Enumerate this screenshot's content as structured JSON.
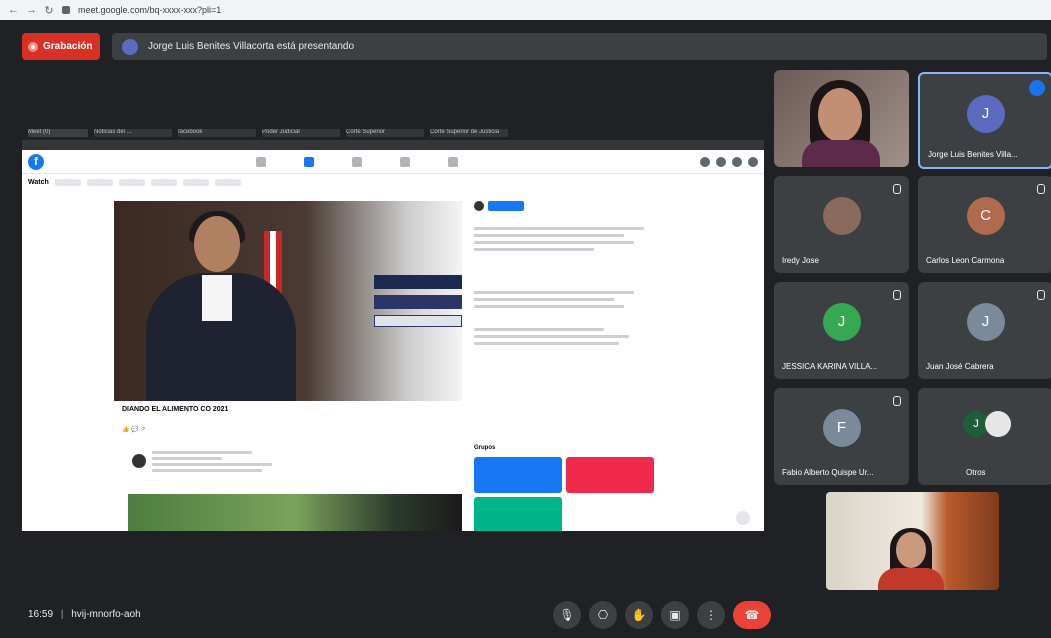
{
  "browser": {
    "back_icon": "arrow-left-icon",
    "forward_icon": "arrow-right-icon",
    "reload_icon": "reload-icon",
    "url": "meet.google.com/bq-xxxx-xxx?pli=1"
  },
  "top_bar": {
    "recording_label": "Grabación",
    "presenting_text": "Jorge Luis Benites Villacorta está presentando"
  },
  "shared_screen": {
    "tabs": [
      "Meet (0)",
      "Noticias del ...",
      "facebook",
      "Poder Judicial",
      "Corte Superior",
      "Corte Superior de Justicia"
    ],
    "watch_label": "Watch",
    "video_title": "DIANDO EL ALIMENTO CO 2021",
    "groups_label": "Grupos"
  },
  "participants": [
    {
      "name": "",
      "type": "camera"
    },
    {
      "name": "Jorge Luis Benites Villa...",
      "initial": "J",
      "color": "#5c6bc0",
      "speaking": true
    },
    {
      "name": "Iredy Jose",
      "initial": "",
      "color": "#8a6a5c"
    },
    {
      "name": "Carlos Leon Carmona",
      "initial": "C",
      "color": "#b06a4e"
    },
    {
      "name": "JESSICA KARINA VILLA...",
      "initial": "J",
      "color": "#34a853"
    },
    {
      "name": "Juan José Cabrera",
      "initial": "J",
      "color": "#7b8a9a"
    },
    {
      "name": "Fabio Alberto Quispe Ur...",
      "initial": "F",
      "color": "#7b8a9a"
    },
    {
      "name": "Otros",
      "initial": "J",
      "color": "#1e5e3a"
    }
  ],
  "meeting": {
    "time": "16:59",
    "code": "hvij-mnorfo-aoh"
  },
  "controls": [
    {
      "name": "microphone-button",
      "icon": "mic-icon",
      "glyph": "🎙"
    },
    {
      "name": "camera-button",
      "icon": "camera-icon",
      "glyph": "⎔"
    },
    {
      "name": "raise-hand-button",
      "icon": "hand-icon",
      "glyph": "✋"
    },
    {
      "name": "present-button",
      "icon": "present-icon",
      "glyph": "▣"
    },
    {
      "name": "more-options-button",
      "icon": "more-vert-icon",
      "glyph": "⋮"
    },
    {
      "name": "leave-call-button",
      "icon": "call-end-icon",
      "glyph": "☎"
    }
  ]
}
